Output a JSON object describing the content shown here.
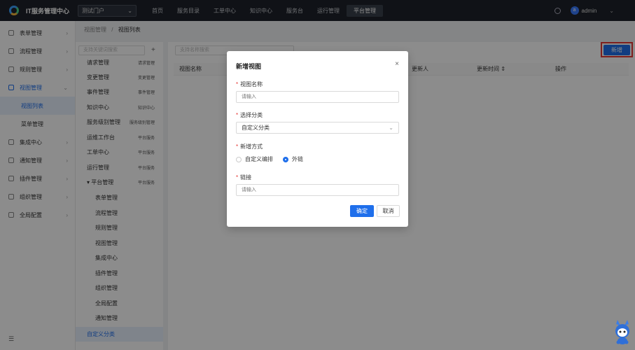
{
  "header": {
    "app_title": "IT服务管理中心",
    "portal_select": "测试门户",
    "nav": [
      "首页",
      "服务目录",
      "工单中心",
      "知识中心",
      "服务台",
      "运行管理",
      "平台管理"
    ],
    "active_nav": "平台管理",
    "avatar_letter": "a",
    "username": "admin"
  },
  "sidebar": {
    "items": [
      {
        "label": "表单管理"
      },
      {
        "label": "流程管理"
      },
      {
        "label": "规则管理"
      },
      {
        "label": "视图管理"
      },
      {
        "label": "集成中心"
      },
      {
        "label": "通知管理"
      },
      {
        "label": "插件管理"
      },
      {
        "label": "组织管理"
      },
      {
        "label": "全局配置"
      }
    ],
    "sub_items": [
      "视图列表",
      "菜单管理"
    ],
    "bottom_icon": "☰"
  },
  "breadcrumb": {
    "parent": "视图管理",
    "sep": "/",
    "current": "视图列表"
  },
  "category": {
    "search_placeholder": "支持关键词搜索",
    "rows": [
      {
        "label": "请求管理",
        "tag": "请求管理"
      },
      {
        "label": "变更管理",
        "tag": "变更管理"
      },
      {
        "label": "事件管理",
        "tag": "事件管理"
      },
      {
        "label": "知识中心",
        "tag": "知识中心"
      },
      {
        "label": "服务级别管理",
        "tag": "服务级别管理"
      },
      {
        "label": "运维工作台",
        "tag": "平台服务"
      },
      {
        "label": "工单中心",
        "tag": "平台服务"
      },
      {
        "label": "运行管理",
        "tag": "平台服务"
      },
      {
        "label": "▾ 平台管理",
        "tag": "平台服务"
      }
    ],
    "sub_rows": [
      "表单管理",
      "流程管理",
      "规则管理",
      "视图管理",
      "集成中心",
      "插件管理",
      "组织管理",
      "全局配置",
      "通知管理"
    ],
    "custom": "自定义分类"
  },
  "list": {
    "search_placeholder": "支持名称搜索",
    "add_button": "新增",
    "columns": [
      "视图名称",
      "更新人",
      "更新时间 ⇕",
      "操作"
    ]
  },
  "modal": {
    "title": "新增视图",
    "close": "×",
    "name_label": "视图名称",
    "name_placeholder": "请输入",
    "category_label": "选择分类",
    "category_value": "自定义分类",
    "method_label": "新增方式",
    "option_custom": "自定义编排",
    "option_link": "外链",
    "link_label": "链接",
    "link_placeholder": "请输入",
    "ok": "确定",
    "cancel": "取消"
  }
}
